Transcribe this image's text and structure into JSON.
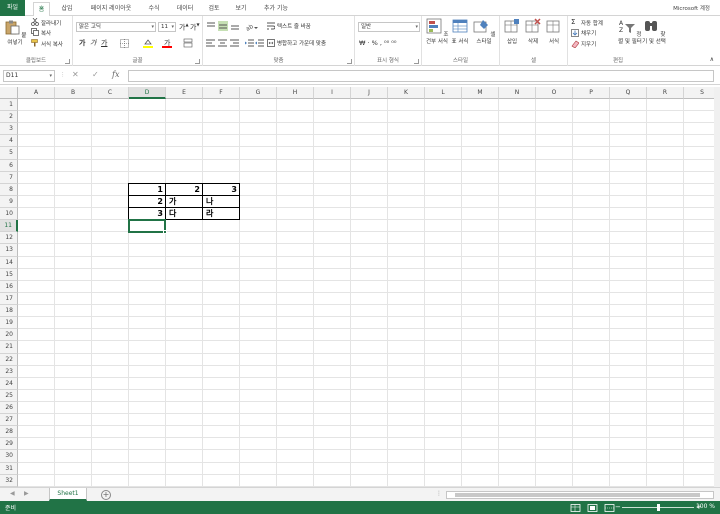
{
  "tabs": [
    "파일",
    "홈",
    "삽입",
    "페이지 레이아웃",
    "수식",
    "데이터",
    "검토",
    "보기",
    "추가 기능"
  ],
  "account": "Microsoft 계정",
  "ribbon": {
    "clipboard": {
      "paste": "붙여넣기",
      "cut": "잘라내기",
      "copy": "복사",
      "format_painter": "서식 복사",
      "label": "클립보드"
    },
    "font": {
      "name": "맑은 고딕",
      "size": "11",
      "bold": "가",
      "italic": "가",
      "underline": "가",
      "label": "글꼴"
    },
    "alignment": {
      "wrap": "텍스트 줄 바꿈",
      "merge": "병합하고 가운데 맞춤",
      "label": "맞춤"
    },
    "number": {
      "format": "일반",
      "label": "표시 형식"
    },
    "styles": {
      "cond": "조건부 서식",
      "table": "표 서식",
      "cell": "셀 스타일",
      "label": "스타일"
    },
    "cells": {
      "insert": "삽입",
      "delete": "삭제",
      "format": "서식",
      "label": "셀"
    },
    "editing": {
      "autosum": "자동 합계",
      "fill": "채우기",
      "clear": "지우기",
      "sort": "정렬 및 필터",
      "find": "찾기 및 선택",
      "label": "편집"
    }
  },
  "formula_bar": {
    "name_box": "D11",
    "fx": "fx",
    "value": ""
  },
  "columns": [
    "A",
    "B",
    "C",
    "D",
    "E",
    "F",
    "G",
    "H",
    "I",
    "J",
    "K",
    "L",
    "M",
    "N",
    "O",
    "P",
    "Q",
    "R",
    "S"
  ],
  "rows": [
    "1",
    "2",
    "3",
    "4",
    "5",
    "6",
    "7",
    "8",
    "9",
    "10",
    "11",
    "12",
    "13",
    "14",
    "15",
    "16",
    "17",
    "18",
    "19",
    "20",
    "21",
    "22",
    "23",
    "24",
    "25",
    "26",
    "27",
    "28",
    "29",
    "30",
    "31",
    "32"
  ],
  "selected_column": "D",
  "selected_row": "11",
  "cells": {
    "D8": "1",
    "E8": "2",
    "F8": "3",
    "D9": "2",
    "E9": "가",
    "F9": "나",
    "D10": "3",
    "E10": "다",
    "F10": "라"
  },
  "sheets": [
    "Sheet1"
  ],
  "status": {
    "text": "준비",
    "zoom": "100 %"
  }
}
